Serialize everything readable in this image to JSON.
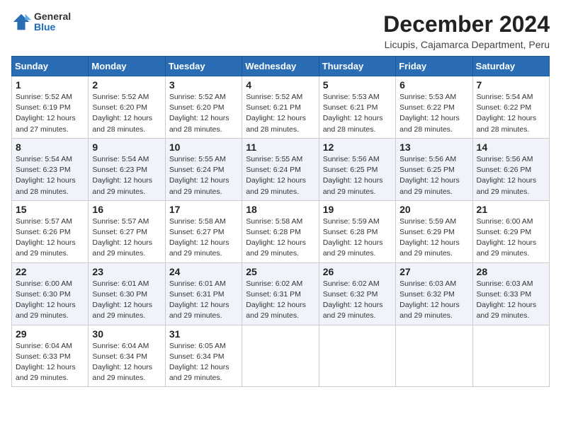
{
  "header": {
    "logo_general": "General",
    "logo_blue": "Blue",
    "title": "December 2024",
    "location": "Licupis, Cajamarca Department, Peru"
  },
  "calendar": {
    "headers": [
      "Sunday",
      "Monday",
      "Tuesday",
      "Wednesday",
      "Thursday",
      "Friday",
      "Saturday"
    ],
    "weeks": [
      [
        {
          "day": "1",
          "detail": "Sunrise: 5:52 AM\nSunset: 6:19 PM\nDaylight: 12 hours\nand 27 minutes."
        },
        {
          "day": "2",
          "detail": "Sunrise: 5:52 AM\nSunset: 6:20 PM\nDaylight: 12 hours\nand 28 minutes."
        },
        {
          "day": "3",
          "detail": "Sunrise: 5:52 AM\nSunset: 6:20 PM\nDaylight: 12 hours\nand 28 minutes."
        },
        {
          "day": "4",
          "detail": "Sunrise: 5:52 AM\nSunset: 6:21 PM\nDaylight: 12 hours\nand 28 minutes."
        },
        {
          "day": "5",
          "detail": "Sunrise: 5:53 AM\nSunset: 6:21 PM\nDaylight: 12 hours\nand 28 minutes."
        },
        {
          "day": "6",
          "detail": "Sunrise: 5:53 AM\nSunset: 6:22 PM\nDaylight: 12 hours\nand 28 minutes."
        },
        {
          "day": "7",
          "detail": "Sunrise: 5:54 AM\nSunset: 6:22 PM\nDaylight: 12 hours\nand 28 minutes."
        }
      ],
      [
        {
          "day": "8",
          "detail": "Sunrise: 5:54 AM\nSunset: 6:23 PM\nDaylight: 12 hours\nand 28 minutes."
        },
        {
          "day": "9",
          "detail": "Sunrise: 5:54 AM\nSunset: 6:23 PM\nDaylight: 12 hours\nand 29 minutes."
        },
        {
          "day": "10",
          "detail": "Sunrise: 5:55 AM\nSunset: 6:24 PM\nDaylight: 12 hours\nand 29 minutes."
        },
        {
          "day": "11",
          "detail": "Sunrise: 5:55 AM\nSunset: 6:24 PM\nDaylight: 12 hours\nand 29 minutes."
        },
        {
          "day": "12",
          "detail": "Sunrise: 5:56 AM\nSunset: 6:25 PM\nDaylight: 12 hours\nand 29 minutes."
        },
        {
          "day": "13",
          "detail": "Sunrise: 5:56 AM\nSunset: 6:25 PM\nDaylight: 12 hours\nand 29 minutes."
        },
        {
          "day": "14",
          "detail": "Sunrise: 5:56 AM\nSunset: 6:26 PM\nDaylight: 12 hours\nand 29 minutes."
        }
      ],
      [
        {
          "day": "15",
          "detail": "Sunrise: 5:57 AM\nSunset: 6:26 PM\nDaylight: 12 hours\nand 29 minutes."
        },
        {
          "day": "16",
          "detail": "Sunrise: 5:57 AM\nSunset: 6:27 PM\nDaylight: 12 hours\nand 29 minutes."
        },
        {
          "day": "17",
          "detail": "Sunrise: 5:58 AM\nSunset: 6:27 PM\nDaylight: 12 hours\nand 29 minutes."
        },
        {
          "day": "18",
          "detail": "Sunrise: 5:58 AM\nSunset: 6:28 PM\nDaylight: 12 hours\nand 29 minutes."
        },
        {
          "day": "19",
          "detail": "Sunrise: 5:59 AM\nSunset: 6:28 PM\nDaylight: 12 hours\nand 29 minutes."
        },
        {
          "day": "20",
          "detail": "Sunrise: 5:59 AM\nSunset: 6:29 PM\nDaylight: 12 hours\nand 29 minutes."
        },
        {
          "day": "21",
          "detail": "Sunrise: 6:00 AM\nSunset: 6:29 PM\nDaylight: 12 hours\nand 29 minutes."
        }
      ],
      [
        {
          "day": "22",
          "detail": "Sunrise: 6:00 AM\nSunset: 6:30 PM\nDaylight: 12 hours\nand 29 minutes."
        },
        {
          "day": "23",
          "detail": "Sunrise: 6:01 AM\nSunset: 6:30 PM\nDaylight: 12 hours\nand 29 minutes."
        },
        {
          "day": "24",
          "detail": "Sunrise: 6:01 AM\nSunset: 6:31 PM\nDaylight: 12 hours\nand 29 minutes."
        },
        {
          "day": "25",
          "detail": "Sunrise: 6:02 AM\nSunset: 6:31 PM\nDaylight: 12 hours\nand 29 minutes."
        },
        {
          "day": "26",
          "detail": "Sunrise: 6:02 AM\nSunset: 6:32 PM\nDaylight: 12 hours\nand 29 minutes."
        },
        {
          "day": "27",
          "detail": "Sunrise: 6:03 AM\nSunset: 6:32 PM\nDaylight: 12 hours\nand 29 minutes."
        },
        {
          "day": "28",
          "detail": "Sunrise: 6:03 AM\nSunset: 6:33 PM\nDaylight: 12 hours\nand 29 minutes."
        }
      ],
      [
        {
          "day": "29",
          "detail": "Sunrise: 6:04 AM\nSunset: 6:33 PM\nDaylight: 12 hours\nand 29 minutes."
        },
        {
          "day": "30",
          "detail": "Sunrise: 6:04 AM\nSunset: 6:34 PM\nDaylight: 12 hours\nand 29 minutes."
        },
        {
          "day": "31",
          "detail": "Sunrise: 6:05 AM\nSunset: 6:34 PM\nDaylight: 12 hours\nand 29 minutes."
        },
        {
          "day": "",
          "detail": ""
        },
        {
          "day": "",
          "detail": ""
        },
        {
          "day": "",
          "detail": ""
        },
        {
          "day": "",
          "detail": ""
        }
      ]
    ]
  }
}
